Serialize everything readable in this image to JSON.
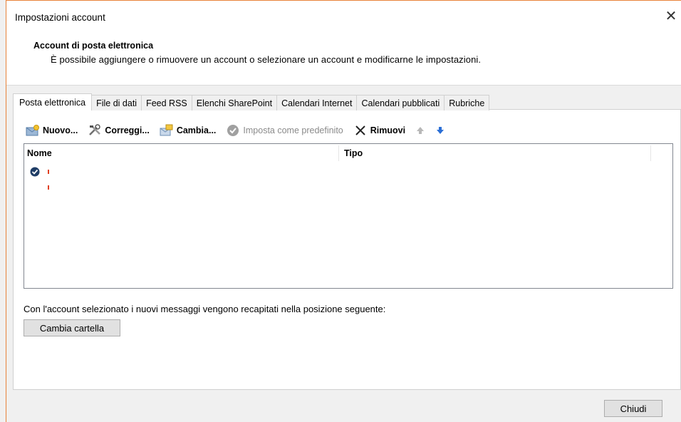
{
  "window": {
    "title": "Impostazioni account",
    "close_glyph": "✕"
  },
  "header": {
    "heading": "Account di posta elettronica",
    "description": "È possibile aggiungere o rimuovere un account o selezionare un account e modificarne le impostazioni."
  },
  "tabs": [
    {
      "label": "Posta elettronica",
      "active": true
    },
    {
      "label": "File di dati",
      "active": false
    },
    {
      "label": "Feed RSS",
      "active": false
    },
    {
      "label": "Elenchi SharePoint",
      "active": false
    },
    {
      "label": "Calendari Internet",
      "active": false
    },
    {
      "label": "Calendari pubblicati",
      "active": false
    },
    {
      "label": "Rubriche",
      "active": false
    }
  ],
  "toolbar": {
    "new_label": "Nuovo...",
    "repair_label": "Correggi...",
    "change_label": "Cambia...",
    "default_label": "Imposta come predefinito",
    "remove_label": "Rimuovi"
  },
  "list": {
    "col_name": "Nome",
    "col_type": "Tipo",
    "rows": [
      {
        "icon": "default-account-check-icon",
        "name": "",
        "type": ""
      }
    ]
  },
  "footer": {
    "delivery_info": "Con l'account selezionato i nuovi messaggi vengono recapitati nella posizione seguente:",
    "change_folder_label": "Cambia cartella",
    "close_label": "Chiudi"
  },
  "colors": {
    "window_accent": "#e8833a",
    "arrow_up_disabled": "#b8b8b8",
    "arrow_down": "#2b6fd6",
    "default_check": "#1f3d66"
  }
}
